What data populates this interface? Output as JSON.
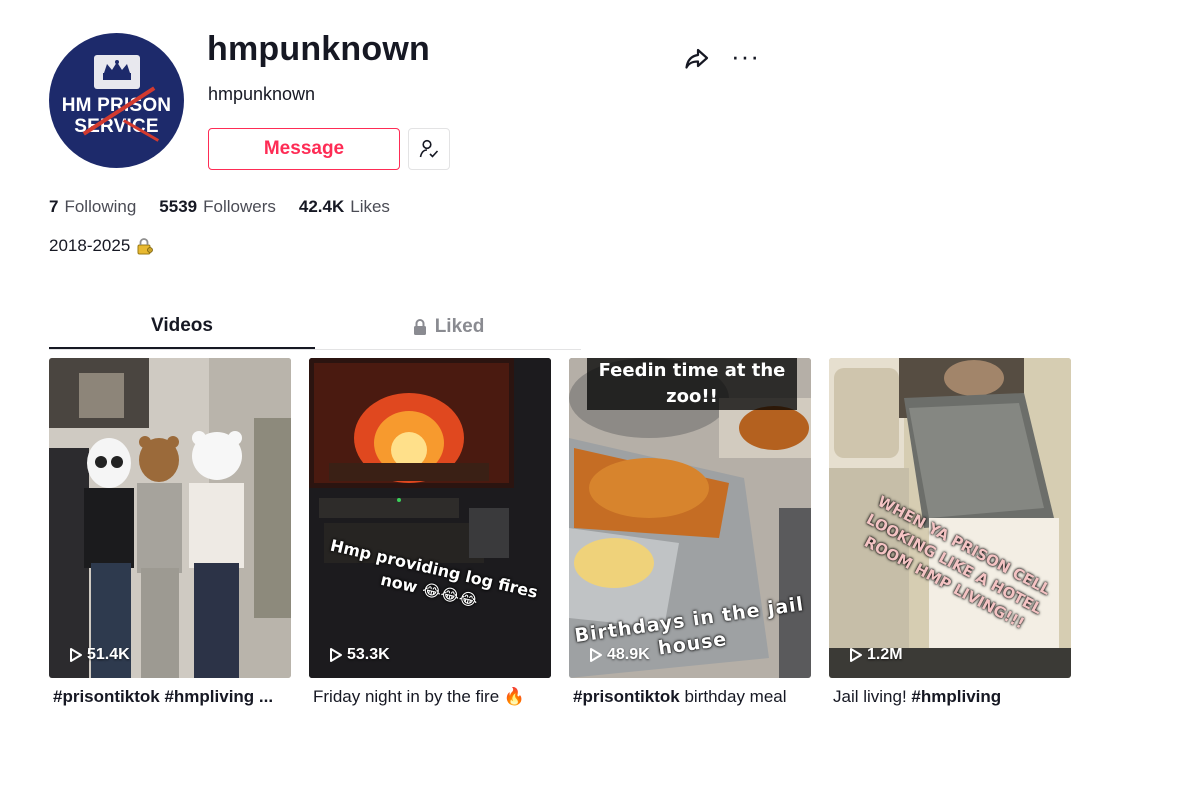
{
  "profile": {
    "username": "hmpunknown",
    "nickname": "hmpunknown",
    "avatar_lines": [
      "HM PRISON",
      "SERVICE"
    ],
    "message_label": "Message",
    "bio": "2018-2025",
    "bio_emoji": "lock-with-key-icon"
  },
  "stats": [
    {
      "value": "7",
      "label": "Following"
    },
    {
      "value": "5539",
      "label": "Followers"
    },
    {
      "value": "42.4K",
      "label": "Likes"
    }
  ],
  "tabs": [
    {
      "label": "Videos",
      "active": true
    },
    {
      "label": "Liked",
      "active": false,
      "icon": "lock-icon"
    }
  ],
  "videos": [
    {
      "views": "51.4K",
      "caption_tags": "#prisontiktok #hmpliving ...",
      "caption_text": "",
      "overlay": ""
    },
    {
      "views": "53.3K",
      "caption_tags": "",
      "caption_text": "Friday night in by the fire",
      "overlay": "Hmp providing log fires now 😂😂😂"
    },
    {
      "views": "48.9K",
      "caption_tags": "#prisontiktok",
      "caption_text": " birthday meal",
      "overlay_top": "Feedin time at the zoo!!",
      "overlay": "Birthdays in the jail house"
    },
    {
      "views": "1.2M",
      "caption_tags": "#hmpliving",
      "caption_text": "Jail living! ",
      "overlay": "WHEN YA PRISON CELL LOOKING LIKE A HOTEL ROOM HMP LIVING!!!"
    }
  ],
  "colors": {
    "accent": "#fe2c55",
    "text": "#161823",
    "muted": "#8a8b91"
  }
}
